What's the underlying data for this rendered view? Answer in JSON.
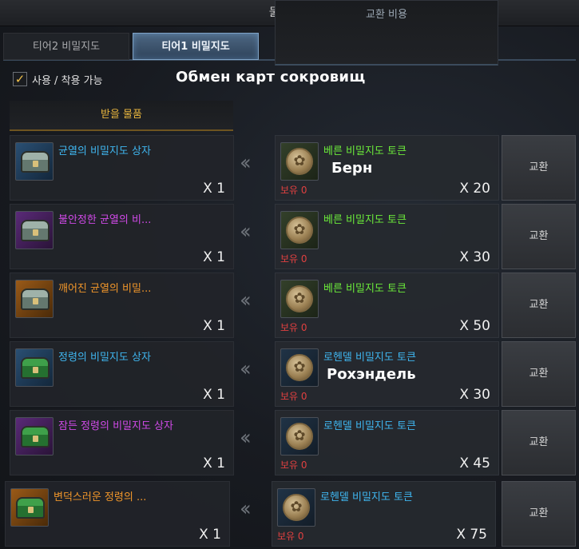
{
  "window": {
    "title": "물물교환"
  },
  "tabs": [
    {
      "label": "티어2 비밀지도"
    },
    {
      "label": "티어1 비밀지도"
    }
  ],
  "filter": {
    "label": "사용 / 착용 가능",
    "checked": true
  },
  "caption": "Обмен карт сокровищ",
  "columns": {
    "receive": "받을 물품",
    "cost": "교환 비용"
  },
  "rows": [
    {
      "item_name": "균열의 비밀지도 상자",
      "item_qty": "X 1",
      "token_name": "베른 비밀지도 토큰",
      "owned": "보유 0",
      "cost_qty": "X 20",
      "note": "Берн",
      "button": "교환"
    },
    {
      "item_name": "불안정한 균열의 비...",
      "item_qty": "X 1",
      "token_name": "베른 비밀지도 토큰",
      "owned": "보유 0",
      "cost_qty": "X 30",
      "note": "",
      "button": "교환"
    },
    {
      "item_name": "깨어진 균열의 비밀...",
      "item_qty": "X 1",
      "token_name": "베른 비밀지도 토큰",
      "owned": "보유 0",
      "cost_qty": "X 50",
      "note": "",
      "button": "교환"
    },
    {
      "item_name": "정령의 비밀지도 상자",
      "item_qty": "X 1",
      "token_name": "로헨델 비밀지도 토큰",
      "owned": "보유 0",
      "cost_qty": "X 30",
      "note": "Рохэндель",
      "button": "교환"
    },
    {
      "item_name": "잠든 정령의 비밀지도 상자",
      "item_qty": "X 1",
      "token_name": "로헨델 비밀지도 토큰",
      "owned": "보유 0",
      "cost_qty": "X 45",
      "note": "",
      "button": "교환"
    },
    {
      "item_name": "변덕스러운 정령의 ...",
      "item_qty": "X 1",
      "token_name": "로헨델 비밀지도 토큰",
      "owned": "보유 0",
      "cost_qty": "X 75",
      "note": "",
      "button": "교환"
    }
  ],
  "colors": {
    "blue_rarity": "#3fb6f0",
    "purple_rarity": "#d04ae8",
    "orange_rarity": "#f0962a",
    "bern_token": "#6bea3a",
    "rohendel_token": "#3fb6f0",
    "owned_zero": "#e04040",
    "header_gold": "#e8b53e"
  },
  "icons": {
    "arrow": "double-chevron-left-icon",
    "item": "treasure-chest-icon",
    "token": "map-token-coin-icon"
  }
}
